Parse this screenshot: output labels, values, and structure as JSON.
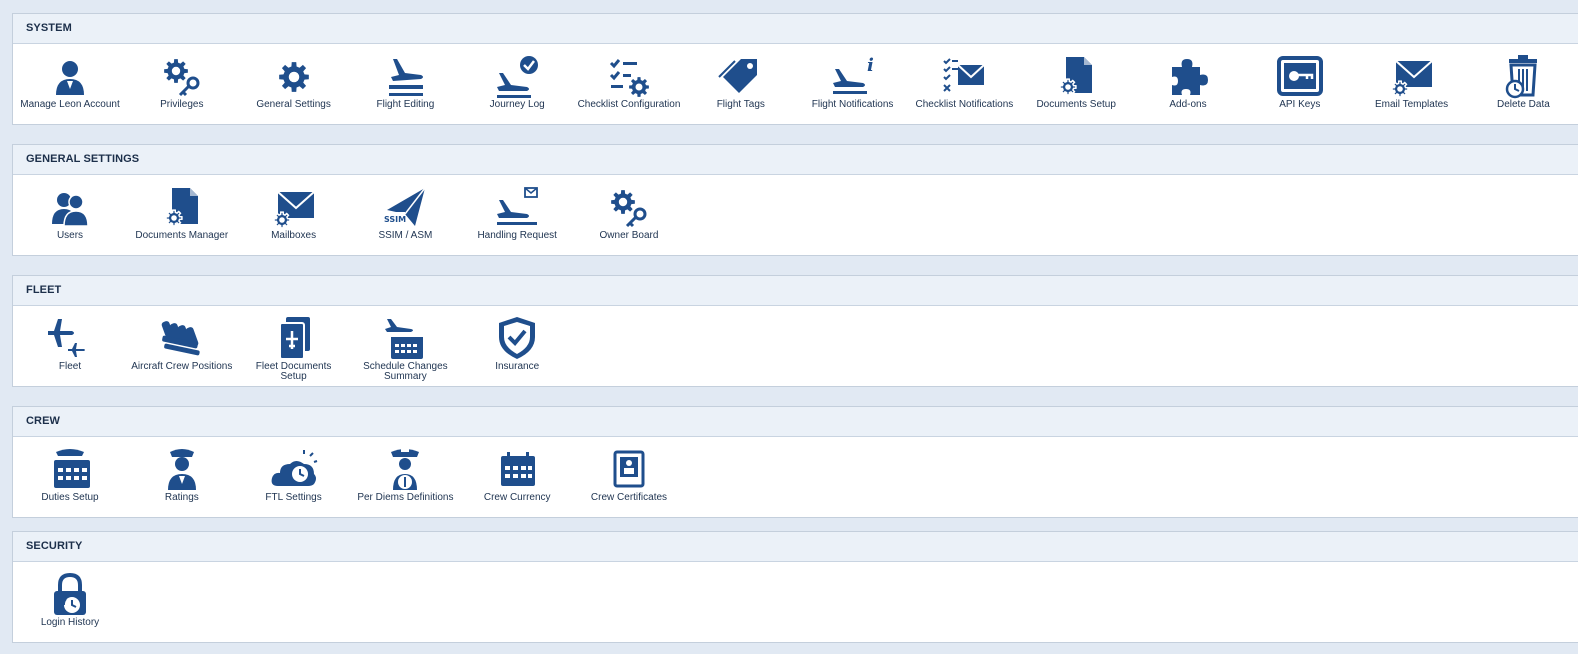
{
  "colors": {
    "icon": "#1f4e8c",
    "header_bg": "#ebf1f8",
    "page_bg": "#e1e9f3"
  },
  "sections": [
    {
      "title": "SYSTEM",
      "items": [
        {
          "label": "Manage Leon Account",
          "icon": "user-icon"
        },
        {
          "label": "Privileges",
          "icon": "gear-key-icon"
        },
        {
          "label": "General Settings",
          "icon": "gear-icon"
        },
        {
          "label": "Flight Editing",
          "icon": "plane-departure-icon"
        },
        {
          "label": "Journey Log",
          "icon": "plane-check-icon"
        },
        {
          "label": "Checklist Configuration",
          "icon": "checklist-gear-icon"
        },
        {
          "label": "Flight Tags",
          "icon": "tag-icon"
        },
        {
          "label": "Flight Notifications",
          "icon": "plane-info-icon"
        },
        {
          "label": "Checklist Notifications",
          "icon": "checklist-mail-icon"
        },
        {
          "label": "Documents Setup",
          "icon": "document-gear-icon"
        },
        {
          "label": "Add-ons",
          "icon": "puzzle-icon"
        },
        {
          "label": "API Keys",
          "icon": "api-key-icon"
        },
        {
          "label": "Email Templates",
          "icon": "mail-gear-icon"
        },
        {
          "label": "Delete Data",
          "icon": "trash-clock-icon"
        }
      ]
    },
    {
      "title": "GENERAL SETTINGS",
      "items": [
        {
          "label": "Users",
          "icon": "users-icon"
        },
        {
          "label": "Documents Manager",
          "icon": "document-gear-icon"
        },
        {
          "label": "Mailboxes",
          "icon": "mail-gear-icon"
        },
        {
          "label": "SSIM / ASM",
          "icon": "ssim-plane-icon",
          "icon_text": "SSIM"
        },
        {
          "label": "Handling Request",
          "icon": "plane-mail-icon"
        },
        {
          "label": "Owner Board",
          "icon": "gear-key-icon"
        }
      ]
    },
    {
      "title": "FLEET",
      "items": [
        {
          "label": "Fleet",
          "icon": "planes-icon"
        },
        {
          "label": "Aircraft Crew Positions",
          "icon": "crew-seats-icon"
        },
        {
          "label": "Fleet Documents Setup",
          "icon": "fleet-documents-icon"
        },
        {
          "label": "Schedule Changes Summary",
          "icon": "plane-calendar-icon"
        },
        {
          "label": "Insurance",
          "icon": "shield-check-icon"
        }
      ]
    },
    {
      "title": "CREW",
      "items": [
        {
          "label": "Duties Setup",
          "icon": "pilot-calendar-icon"
        },
        {
          "label": "Ratings",
          "icon": "pilot-icon"
        },
        {
          "label": "FTL Settings",
          "icon": "cloud-clock-icon"
        },
        {
          "label": "Per Diems Definitions",
          "icon": "pilot-money-icon"
        },
        {
          "label": "Crew Currency",
          "icon": "calendar-icon"
        },
        {
          "label": "Crew Certificates",
          "icon": "certificate-icon"
        }
      ]
    },
    {
      "title": "SECURITY",
      "items": [
        {
          "label": "Login History",
          "icon": "lock-history-icon"
        }
      ]
    }
  ]
}
